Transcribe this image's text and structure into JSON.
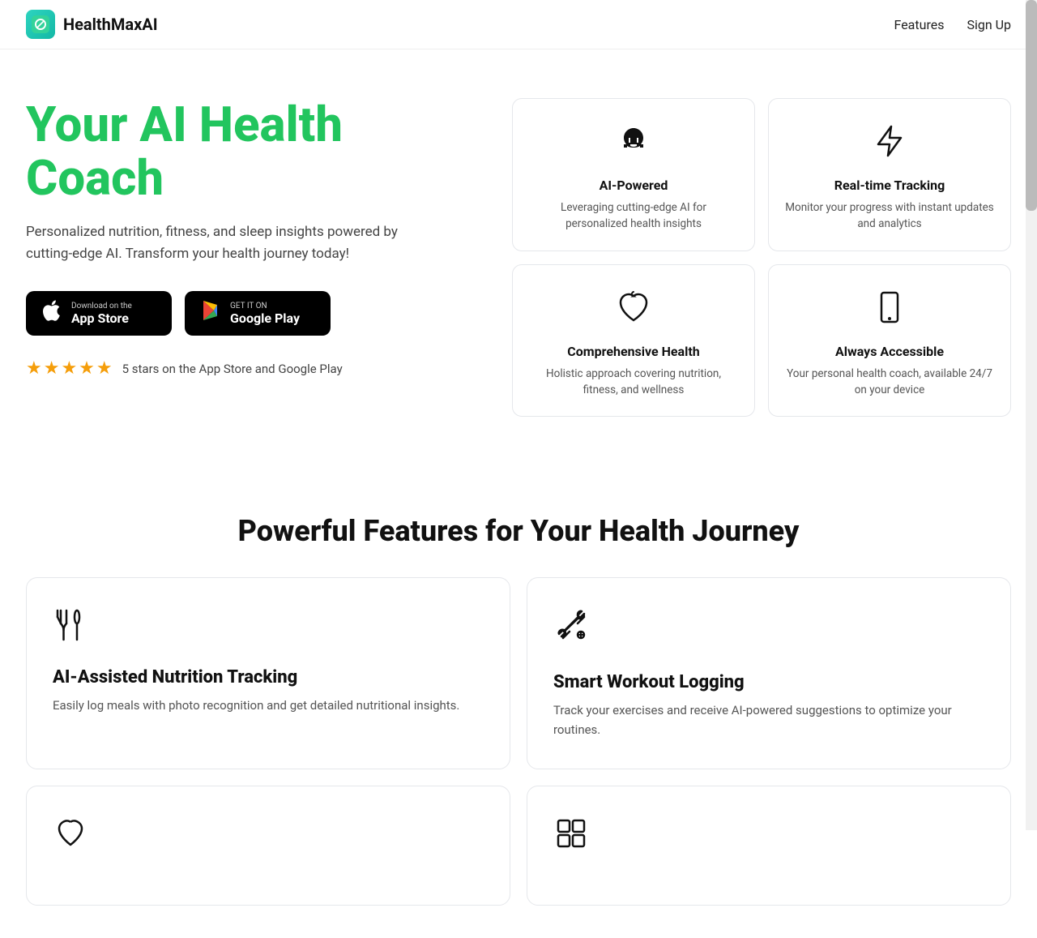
{
  "brand": {
    "logo_symbol": "⊕",
    "title": "HealthMaxAI"
  },
  "navbar": {
    "links": [
      {
        "label": "Features",
        "id": "features"
      },
      {
        "label": "Sign Up",
        "id": "signup"
      }
    ]
  },
  "hero": {
    "heading": "Your AI Health\nCoach",
    "subtext": "Personalized nutrition, fitness, and sleep insights powered by cutting-edge AI. Transform your health journey today!",
    "app_store": {
      "small_text": "Download on the",
      "big_text": "App Store"
    },
    "google_play": {
      "small_text": "GET IT ON",
      "big_text": "Google Play"
    },
    "rating_text": "5 stars on the App Store and Google Play"
  },
  "mini_features": [
    {
      "id": "ai-powered",
      "icon": "🧠",
      "title": "AI-Powered",
      "desc": "Leveraging cutting-edge AI for personalized health insights"
    },
    {
      "id": "realtime-tracking",
      "icon": "⚡",
      "title": "Real-time Tracking",
      "desc": "Monitor your progress with instant updates and analytics"
    },
    {
      "id": "comprehensive-health",
      "icon": "🍎",
      "title": "Comprehensive Health",
      "desc": "Holistic approach covering nutrition, fitness, and wellness"
    },
    {
      "id": "always-accessible",
      "icon": "📱",
      "title": "Always Accessible",
      "desc": "Your personal health coach, available 24/7 on your device"
    }
  ],
  "features_section": {
    "heading": "Powerful Features for Your Health Journey",
    "features": [
      {
        "id": "nutrition-tracking",
        "icon": "🍴",
        "title": "AI-Assisted Nutrition Tracking",
        "desc": "Easily log meals with photo recognition and get detailed nutritional insights."
      },
      {
        "id": "workout-logging",
        "icon": "🛠",
        "title": "Smart Workout Logging",
        "desc": "Track your exercises and receive AI-powered suggestions to optimize your routines."
      }
    ],
    "partial_features": [
      {
        "id": "partial-1",
        "icon": "✍"
      },
      {
        "id": "partial-2",
        "icon": "📊"
      }
    ]
  },
  "stars": "★★★★★"
}
